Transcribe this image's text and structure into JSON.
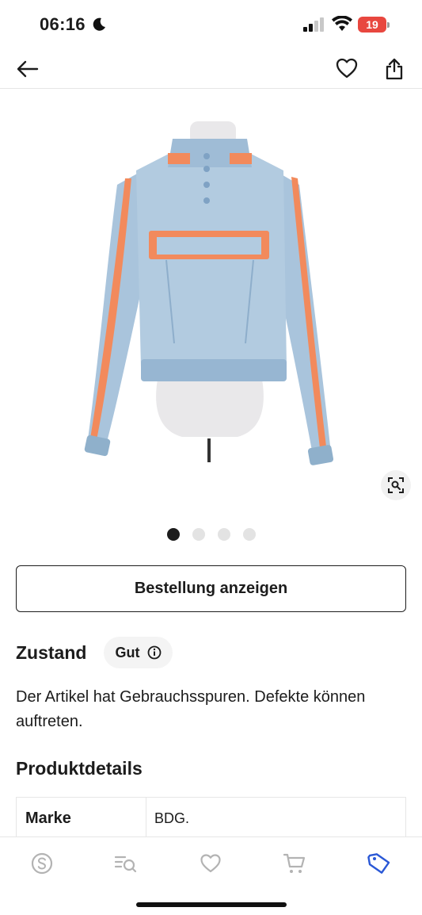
{
  "status_bar": {
    "time": "06:16",
    "battery": "19",
    "icons": [
      "moon-icon",
      "signal-icon",
      "wifi-icon",
      "battery-icon"
    ]
  },
  "topbar": {
    "icons": [
      "arrow-left-icon",
      "heart-icon",
      "share-icon"
    ]
  },
  "gallery": {
    "image": "denim-jacket-photo",
    "page_count": 4,
    "active_page": 1,
    "lens_icon": "visual-search-icon"
  },
  "actions": {
    "order_button": "Bestellung anzeigen"
  },
  "condition": {
    "title": "Zustand",
    "value": "Gut",
    "info_icon": "info-icon",
    "description": "Der Artikel hat Gebrauchsspuren. Defekte können auftreten."
  },
  "details": {
    "title": "Produktdetails",
    "rows": [
      {
        "key": "Marke",
        "value": "BDG."
      }
    ]
  },
  "tabbar": {
    "icons": [
      "sellpy-icon",
      "search-list-icon",
      "heart-icon",
      "cart-icon",
      "tag-icon"
    ],
    "active_index": 4,
    "active_color": "#2a58d6",
    "inactive_color": "#b3b3b3"
  },
  "colors": {
    "text": "#1c1c1c",
    "battery": "#e8473f",
    "denim": "#a9c4dc",
    "accent_orange": "#f28a5c"
  }
}
